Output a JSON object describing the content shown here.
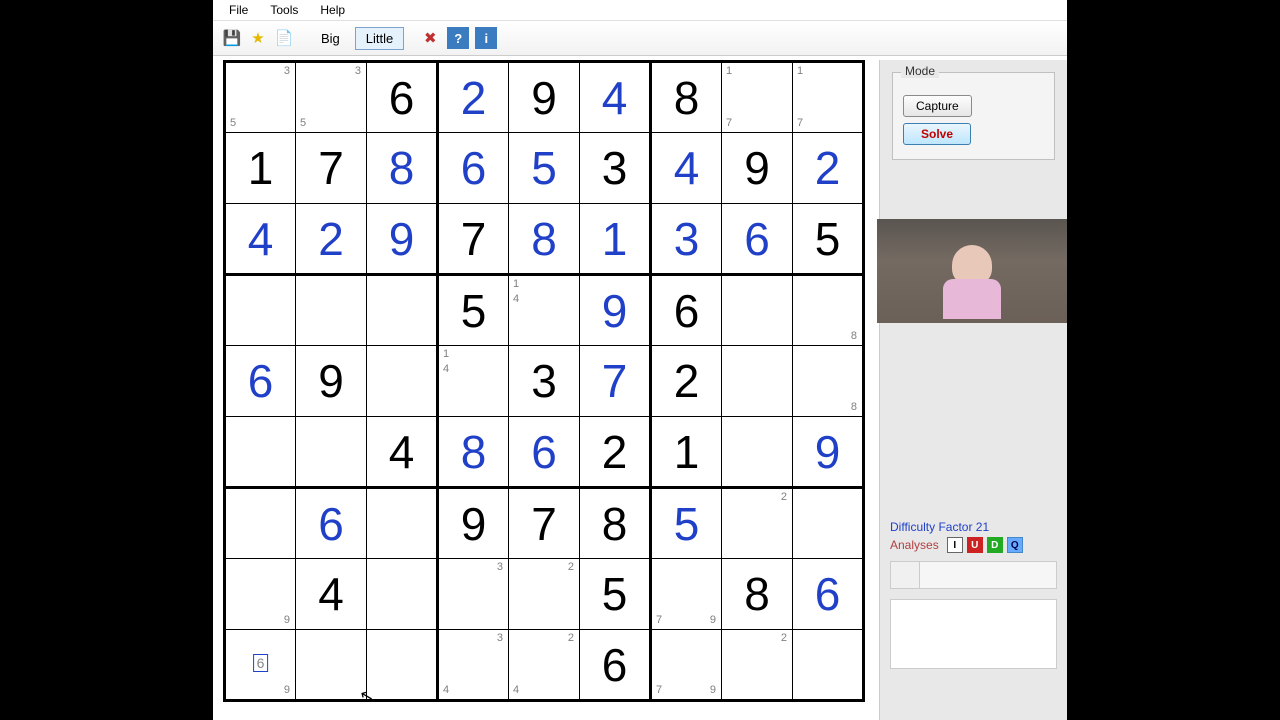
{
  "menu": {
    "file": "File",
    "tools": "Tools",
    "help": "Help"
  },
  "toolbar": {
    "big": "Big",
    "little": "Little",
    "help": "?",
    "info": "i"
  },
  "sidebar": {
    "mode_label": "Mode",
    "capture": "Capture",
    "solve": "Solve",
    "difficulty": "Difficulty Factor 21",
    "analyses_label": "Analyses",
    "analyses": [
      "I",
      "U",
      "D",
      "Q"
    ]
  },
  "sudoku": {
    "grid": [
      [
        {
          "pm": {
            "tr": "3",
            "bl": "5"
          }
        },
        {
          "pm": {
            "tr": "3",
            "bl": "5"
          }
        },
        {
          "v": "6",
          "t": "g"
        },
        {
          "v": "2",
          "t": "s"
        },
        {
          "v": "9",
          "t": "g"
        },
        {
          "v": "4",
          "t": "s"
        },
        {
          "v": "8",
          "t": "g"
        },
        {
          "pm": {
            "tl": "1",
            "bl": "7"
          }
        },
        {
          "pm": {
            "tl": "1",
            "bl": "7"
          }
        }
      ],
      [
        {
          "v": "1",
          "t": "g"
        },
        {
          "v": "7",
          "t": "g"
        },
        {
          "v": "8",
          "t": "s"
        },
        {
          "v": "6",
          "t": "s"
        },
        {
          "v": "5",
          "t": "s"
        },
        {
          "v": "3",
          "t": "g"
        },
        {
          "v": "4",
          "t": "s"
        },
        {
          "v": "9",
          "t": "g"
        },
        {
          "v": "2",
          "t": "s"
        }
      ],
      [
        {
          "v": "4",
          "t": "s"
        },
        {
          "v": "2",
          "t": "s"
        },
        {
          "v": "9",
          "t": "s"
        },
        {
          "v": "7",
          "t": "g"
        },
        {
          "v": "8",
          "t": "s"
        },
        {
          "v": "1",
          "t": "s"
        },
        {
          "v": "3",
          "t": "s"
        },
        {
          "v": "6",
          "t": "s"
        },
        {
          "v": "5",
          "t": "g"
        }
      ],
      [
        {},
        {},
        {},
        {
          "v": "5",
          "t": "g"
        },
        {
          "pm": {
            "tl": "1",
            "l2": "4"
          }
        },
        {
          "v": "9",
          "t": "s"
        },
        {
          "v": "6",
          "t": "g"
        },
        {},
        {
          "pm": {
            "br": "8"
          }
        }
      ],
      [
        {
          "v": "6",
          "t": "s"
        },
        {
          "v": "9",
          "t": "g"
        },
        {},
        {
          "pm": {
            "tl": "1",
            "l2": "4"
          }
        },
        {
          "v": "3",
          "t": "g"
        },
        {
          "v": "7",
          "t": "s"
        },
        {
          "v": "2",
          "t": "g"
        },
        {},
        {
          "pm": {
            "br": "8"
          }
        }
      ],
      [
        {},
        {},
        {
          "v": "4",
          "t": "g"
        },
        {
          "v": "8",
          "t": "s"
        },
        {
          "v": "6",
          "t": "s"
        },
        {
          "v": "2",
          "t": "g"
        },
        {
          "v": "1",
          "t": "g"
        },
        {},
        {
          "v": "9",
          "t": "s"
        }
      ],
      [
        {},
        {
          "v": "6",
          "t": "s"
        },
        {},
        {
          "v": "9",
          "t": "g"
        },
        {
          "v": "7",
          "t": "g"
        },
        {
          "v": "8",
          "t": "g"
        },
        {
          "v": "5",
          "t": "s"
        },
        {
          "pm": {
            "tr": "2"
          }
        },
        {}
      ],
      [
        {
          "pm": {
            "br": "9"
          }
        },
        {
          "v": "4",
          "t": "g"
        },
        {},
        {
          "pm": {
            "tr": "3"
          }
        },
        {
          "pm": {
            "tr": "2"
          }
        },
        {
          "v": "5",
          "t": "g"
        },
        {
          "pm": {
            "bl": "7",
            "br": "9"
          }
        },
        {
          "v": "8",
          "t": "g"
        },
        {
          "v": "6",
          "t": "s"
        }
      ],
      [
        {
          "pm": {
            "br": "9"
          },
          "ghost": "6"
        },
        {},
        {},
        {
          "pm": {
            "tr": "3",
            "bl": "4"
          }
        },
        {
          "pm": {
            "tr": "2",
            "bl": "4"
          }
        },
        {
          "v": "6",
          "t": "g"
        },
        {
          "pm": {
            "bl": "7",
            "br": "9"
          }
        },
        {
          "pm": {
            "tr": "2"
          }
        },
        {}
      ]
    ]
  }
}
